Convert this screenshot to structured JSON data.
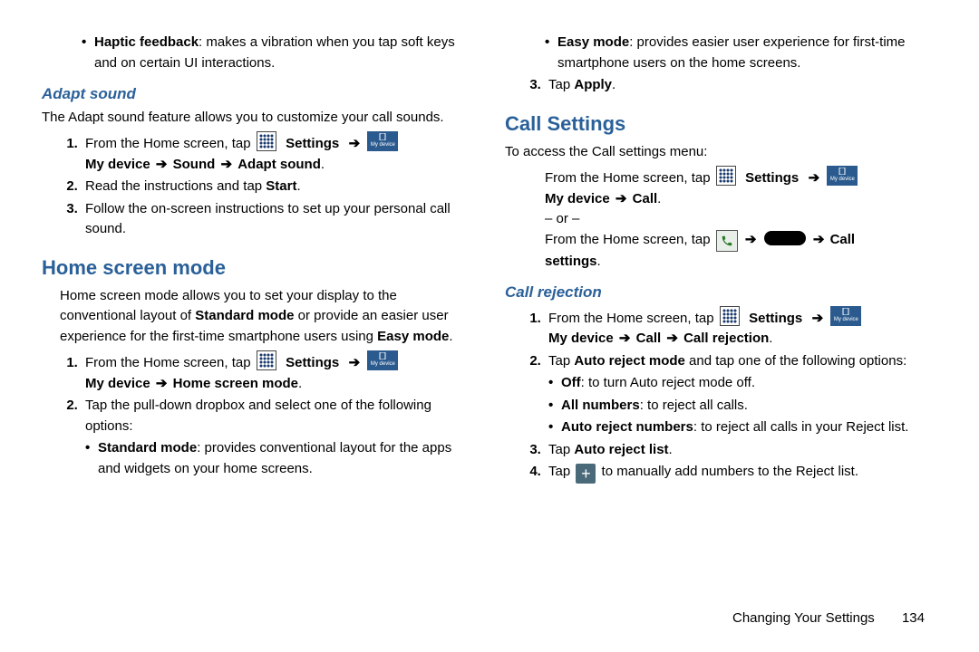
{
  "left": {
    "haptic": {
      "label": "Haptic feedback",
      "text": ": makes a vibration when you tap soft keys and on certain UI interactions."
    },
    "adapt": {
      "title": "Adapt sound",
      "intro": "The Adapt sound feature allows you to customize your call sounds.",
      "step1_a": "From the Home screen, tap ",
      "settings": "Settings",
      "mydevice": "My device",
      "path_b": "Sound",
      "path_c": "Adapt sound",
      "step2_a": "Read the instructions and tap ",
      "step2_b": "Start",
      "step3": "Follow the on-screen instructions to set up your personal call sound."
    },
    "home": {
      "title": "Home screen mode",
      "intro_a": "Home screen mode allows you to set your display to the conventional layout of ",
      "intro_b": "Standard mode",
      "intro_c": " or provide an easier user experience for the first-time smartphone users using ",
      "intro_d": "Easy mode",
      "step1_a": "From the Home screen, tap ",
      "settings": "Settings",
      "mydevice": "My device",
      "path_b": "Home screen mode",
      "step2": "Tap the pull-down dropbox and select one of the following options:",
      "std_label": "Standard mode",
      "std_text": ": provides conventional layout for the apps and widgets on your home screens."
    }
  },
  "right": {
    "easy_label": "Easy mode",
    "easy_text": ": provides easier user experience for first-time smartphone users on the home screens.",
    "step3_a": "Tap ",
    "step3_b": "Apply",
    "call": {
      "title": "Call Settings",
      "intro": "To access the Call settings menu:",
      "line1_a": "From the Home screen, tap ",
      "settings": "Settings",
      "mydevice": "My device",
      "call": "Call",
      "or": "– or –",
      "line2_a": "From the Home screen, tap ",
      "line2_call": "Call settings"
    },
    "rej": {
      "title": "Call rejection",
      "step1_a": "From the Home screen, tap ",
      "settings": "Settings",
      "mydevice": "My device",
      "call": "Call",
      "callrej": "Call rejection",
      "step2_a": "Tap ",
      "step2_b": "Auto reject mode",
      "step2_c": " and tap one of the following options:",
      "off_label": "Off",
      "off_text": ": to turn Auto reject mode off.",
      "all_label": "All numbers",
      "all_text": ": to reject all calls.",
      "arn_label": "Auto reject numbers",
      "arn_text": ": to reject all calls in your Reject list.",
      "step3_a": "Tap ",
      "step3_b": "Auto reject list",
      "step4_a": "Tap ",
      "step4_b": " to manually add numbers to the Reject list."
    }
  },
  "footer": {
    "section": "Changing Your Settings",
    "page": "134"
  },
  "icons": {
    "mydevice_label": "My device"
  }
}
